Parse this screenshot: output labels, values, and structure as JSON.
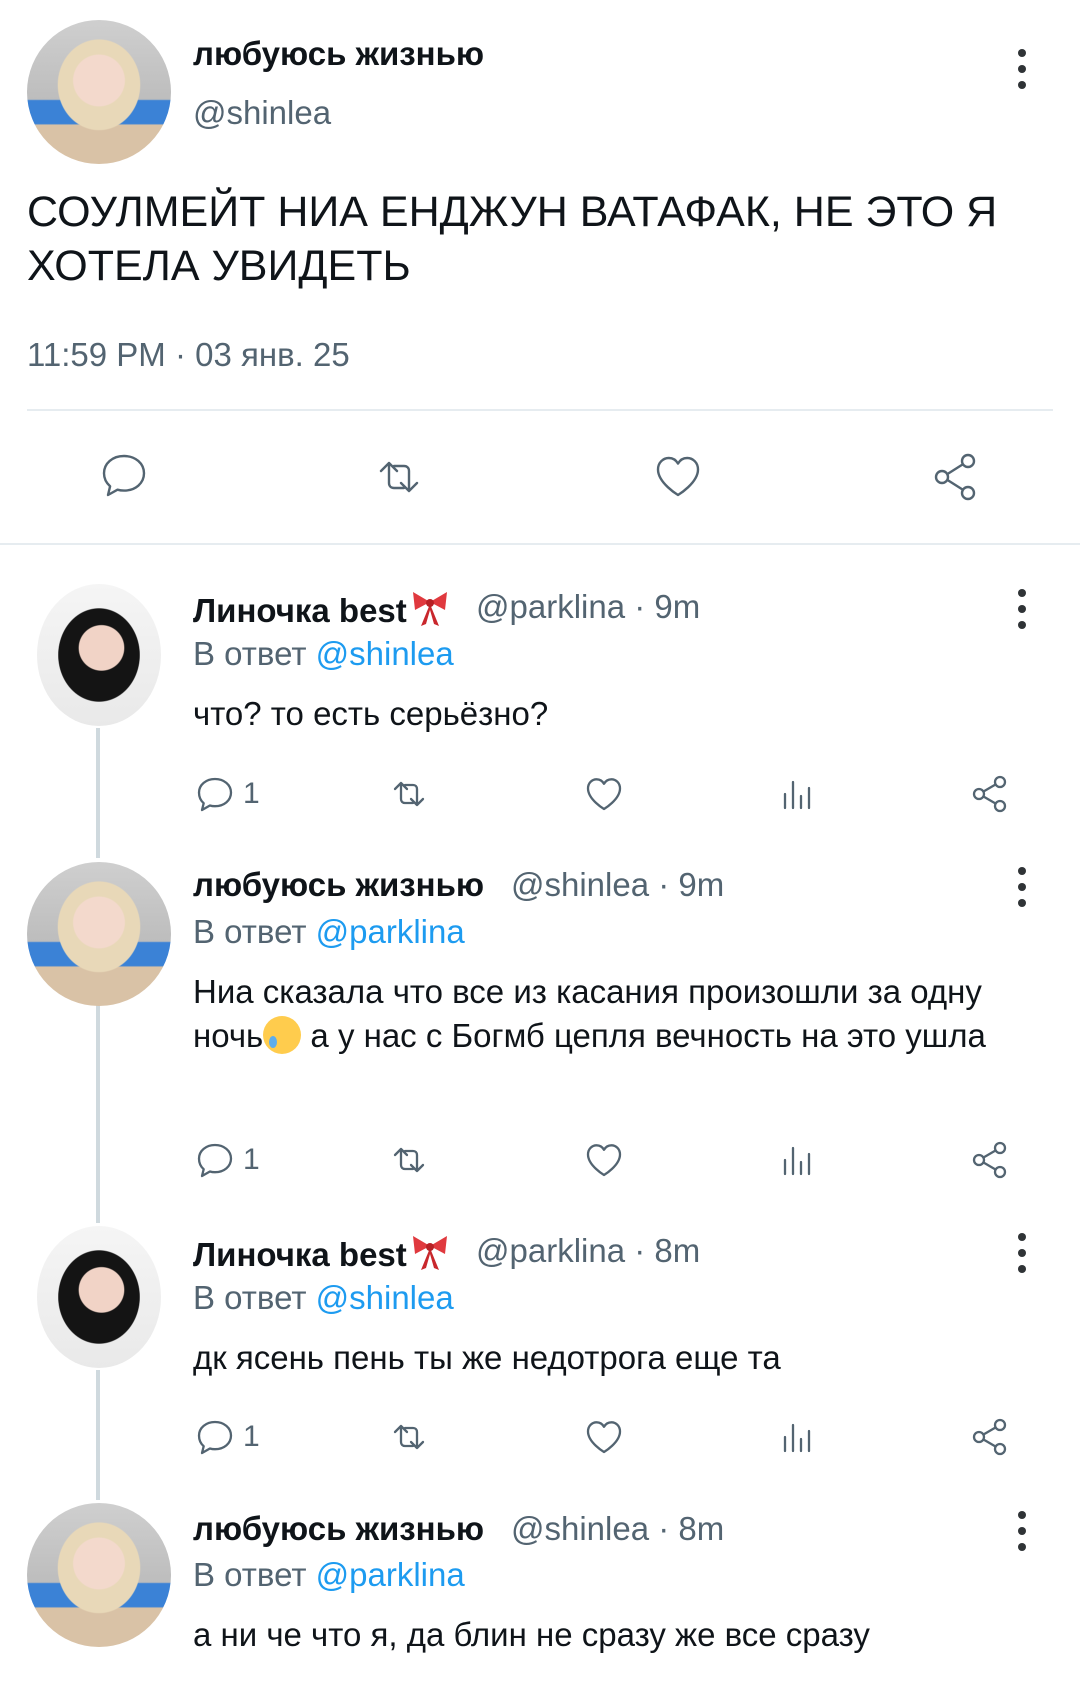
{
  "main_tweet": {
    "author_name": "любуюсь жизнью",
    "author_handle": "@shinlea",
    "text": "СОУЛМЕЙТ НИА ЕНДЖУН ВАТАФАК, НЕ ЭТО Я ХОТЕЛА УВИДЕТЬ",
    "timestamp": "11:59 PM · 03 янв. 25",
    "actions": [
      "reply-icon",
      "retweet-icon",
      "like-icon",
      "share-icon"
    ]
  },
  "replies": [
    {
      "name": "Линочка best",
      "name_emoji": "ribbon-icon",
      "meta": "@parklina · 9m",
      "reply_prefix": "В ответ",
      "reply_to": "@shinlea",
      "text": "что? то есть серьёзно?",
      "reply_count": "1"
    },
    {
      "name": "любуюсь жизнью",
      "meta": "@shinlea · 9m",
      "reply_prefix": "В ответ",
      "reply_to": "@parklina",
      "text_part1": "Ниа сказала что все из касания произошли за одну ночь",
      "text_emoji": "smiling-face-with-tear-icon",
      "text_part2": " а у нас с Богмб цепля вечность на это ушла",
      "reply_count": "1"
    },
    {
      "name": "Линочка best",
      "name_emoji": "ribbon-icon",
      "meta": "@parklina · 8m",
      "reply_prefix": "В ответ",
      "reply_to": "@shinlea",
      "text": "дк ясень пень ты же недотрога еще та",
      "reply_count": "1"
    },
    {
      "name": "любуюсь жизнью",
      "meta": "@shinlea · 8m",
      "reply_prefix": "В ответ",
      "reply_to": "@parklina",
      "text": "а ни че что я, да блин не сразу же все сразу"
    }
  ],
  "colors": {
    "text": "#0f1419",
    "secondary": "#536471",
    "mention": "#1d9bf0",
    "divider": "#e6ecf0",
    "bow": "#e0393e"
  }
}
